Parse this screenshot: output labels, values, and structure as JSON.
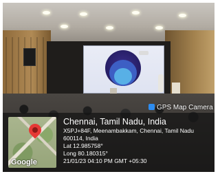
{
  "overlay": {
    "app_label": "GPS Map Camera",
    "city_line": "Chennai, Tamil Nadu, India",
    "address_line1": "X5PJ+84F, Meenambakkam, Chennai, Tamil Nadu",
    "address_line2": "600114, India",
    "lat": "Lat 12.985758°",
    "long": "Long 80.180315°",
    "datetime": "21/01/23 04:10 PM GMT +05:30",
    "map_logo": "Google",
    "pin_color": "#e53935",
    "icons": [
      "camera-icon",
      "map-pin-icon"
    ]
  }
}
